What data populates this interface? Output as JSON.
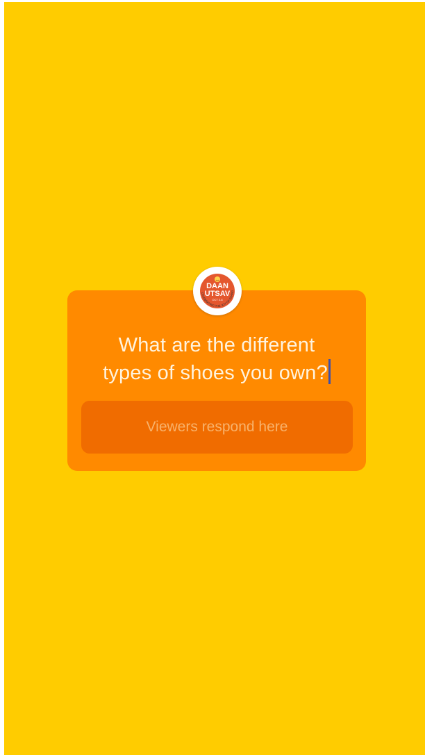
{
  "story": {
    "background_color": "#ffcc00",
    "question_box_color": "#ff8a00",
    "response_field_color": "#f06c00"
  },
  "logo": {
    "text_line1": "DAAN",
    "text_line2": "UTSAV",
    "tagline": "CELEBRATING THE JOY OF GIVING WEEK",
    "dates": "OCT 2-8",
    "brand_color": "#e4572e"
  },
  "question": {
    "line1": "What are the different",
    "line2": "types of shoes you own?"
  },
  "response": {
    "placeholder": "Viewers respond here"
  }
}
